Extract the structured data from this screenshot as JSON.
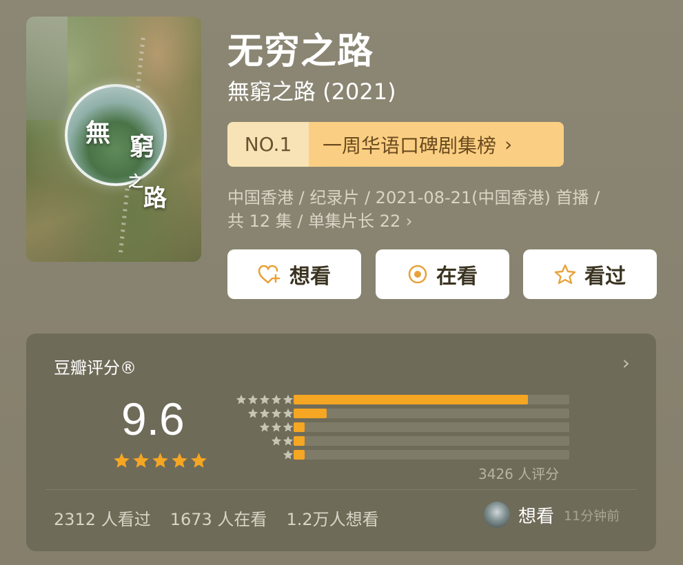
{
  "header": {
    "title": "无穷之路",
    "subtitle": "無窮之路 (2021)"
  },
  "poster": {
    "title_chars": [
      "無",
      "窮",
      "之",
      "路"
    ]
  },
  "ranking": {
    "position": "NO.1",
    "label": "一周华语口碑剧集榜",
    "chevron": "›"
  },
  "meta": {
    "line1": "中国香港 / 纪录片 / 2021-08-21(中国香港) 首播 /",
    "line2": "共 12 集 / 单集片长 22 ›"
  },
  "actions": {
    "want_label": "想看",
    "watching_label": "在看",
    "watched_label": "看过"
  },
  "rating": {
    "title": "豆瓣评分®",
    "chevron": "›",
    "score": "9.6",
    "score_stars": 5,
    "rater_count": "3426 人评分",
    "distribution": [
      {
        "stars": 5,
        "fraction": 0.85
      },
      {
        "stars": 4,
        "fraction": 0.12
      },
      {
        "stars": 3,
        "fraction": 0.04
      },
      {
        "stars": 2,
        "fraction": 0.04
      },
      {
        "stars": 1,
        "fraction": 0.04
      }
    ]
  },
  "stats": {
    "watched": "2312 人看过",
    "watching": "1673 人在看",
    "want": "1.2万人想看"
  },
  "recent_activity": {
    "action": "想看",
    "time": "11分钟前"
  },
  "colors": {
    "accent": "#f5a623",
    "badge_left": "#f7e3b5",
    "badge_right": "#fbcf83",
    "icon_orange": "#e8a23a"
  }
}
